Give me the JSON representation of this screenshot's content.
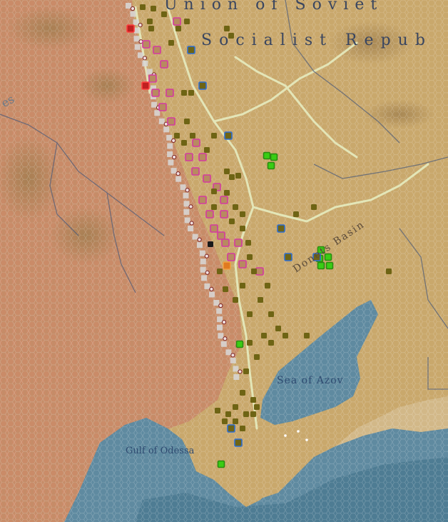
{
  "map": {
    "labels": {
      "union": "Union of Soviet",
      "socialist": "Socialist Repub",
      "donets": "Donets Basin",
      "sea_of_azov": "Sea of Azov",
      "gulf_of_odessa": "Gulf of Odessa",
      "edge_fragment": "es"
    },
    "colors": {
      "axis_territory": "#c8906a",
      "soviet_territory": "#c9a86c",
      "sea": "#5f8aa0",
      "deep_sea": "#4a7890",
      "river": "#e6ecc0",
      "border": "#4a5a7a",
      "axis_unit": "#d43aa0",
      "soviet_unit": "#6e6414",
      "soviet_mech_unit": "#3acd14",
      "hq_unit": "#2f6fd4",
      "fort": "#d8d8d8"
    },
    "unit_types": [
      "axis-infantry-unit-icon",
      "soviet-infantry-unit-icon",
      "soviet-tank-unit-icon",
      "soviet-hq-unit-icon",
      "fortification-icon",
      "airbase-icon"
    ]
  }
}
